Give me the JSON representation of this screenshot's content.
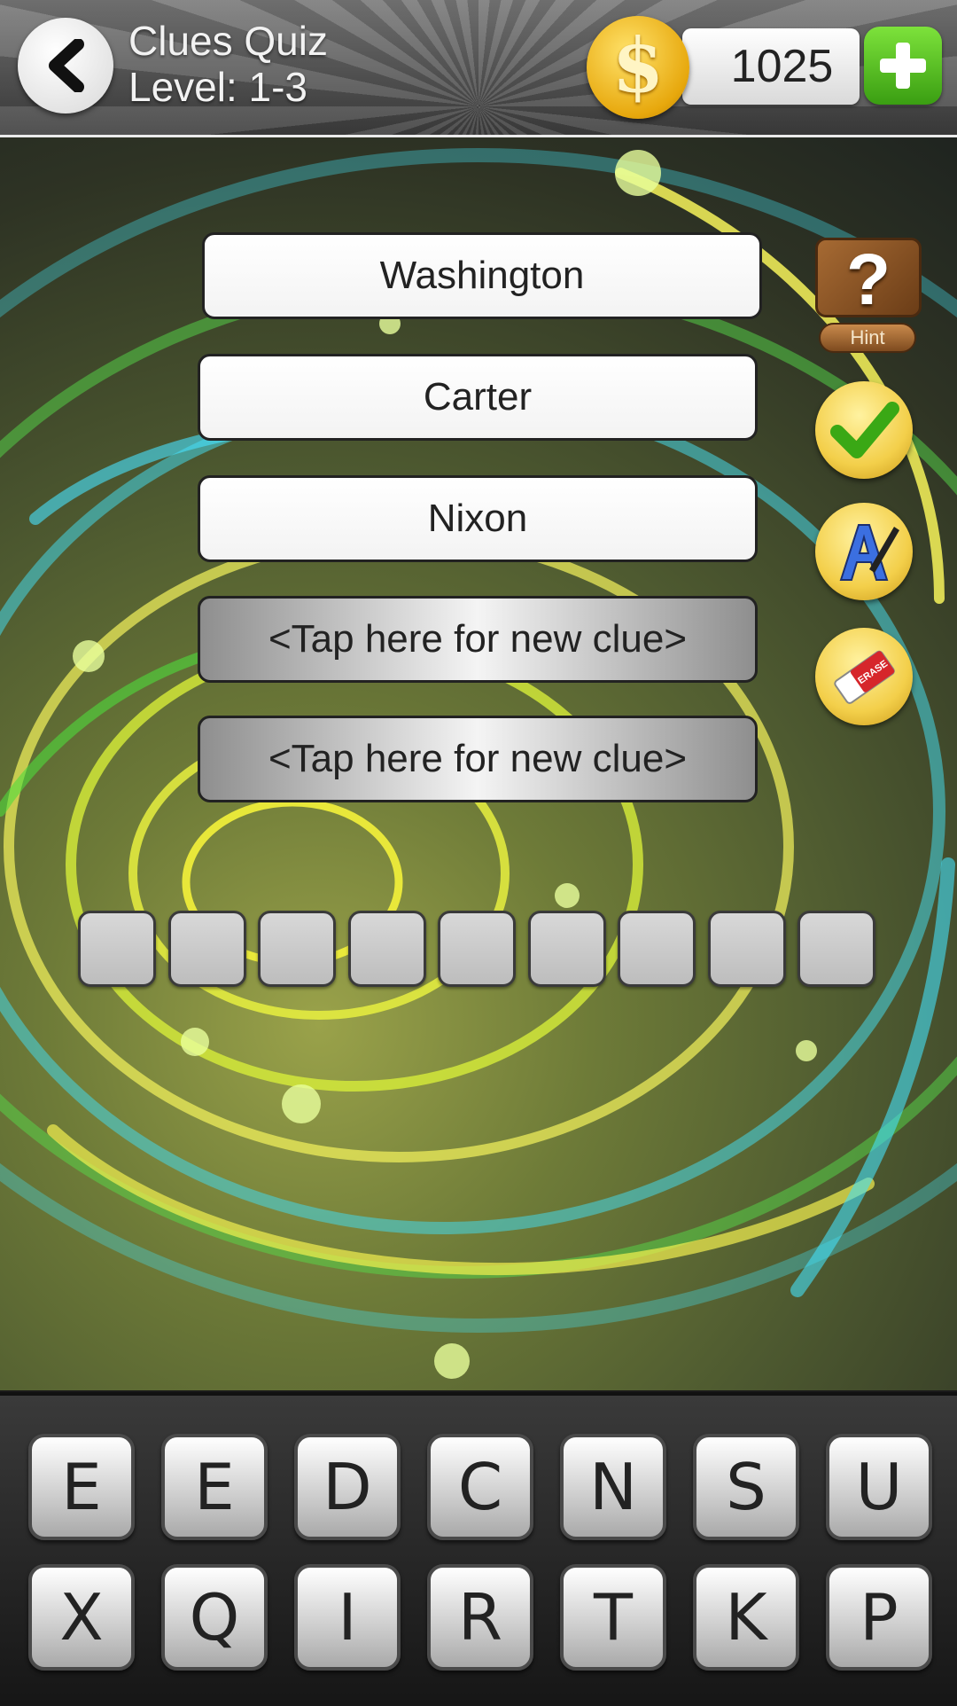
{
  "header": {
    "title": "Clues Quiz",
    "level": "Level: 1-3",
    "coins": "1025",
    "coin_symbol": "$"
  },
  "clues": [
    {
      "text": "Washington",
      "state": "revealed"
    },
    {
      "text": "Carter",
      "state": "revealed"
    },
    {
      "text": "Nixon",
      "state": "revealed"
    },
    {
      "text": "<Tap here for new clue>",
      "state": "hidden"
    },
    {
      "text": "<Tap here for new clue>",
      "state": "hidden"
    }
  ],
  "answer": {
    "length": 9,
    "letters": [
      "",
      "",
      "",
      "",
      "",
      "",
      "",
      "",
      ""
    ]
  },
  "tools": {
    "hint_label": "Hint",
    "hint_symbol": "?",
    "eraser_label": "ERASE"
  },
  "keyboard": {
    "row1": [
      "E",
      "E",
      "D",
      "C",
      "N",
      "S",
      "U"
    ],
    "row2": [
      "X",
      "Q",
      "I",
      "R",
      "T",
      "K",
      "P"
    ]
  },
  "colors": {
    "add_button": "#3a9e12",
    "coin": "#e7a80d",
    "check": "#3aa815"
  }
}
